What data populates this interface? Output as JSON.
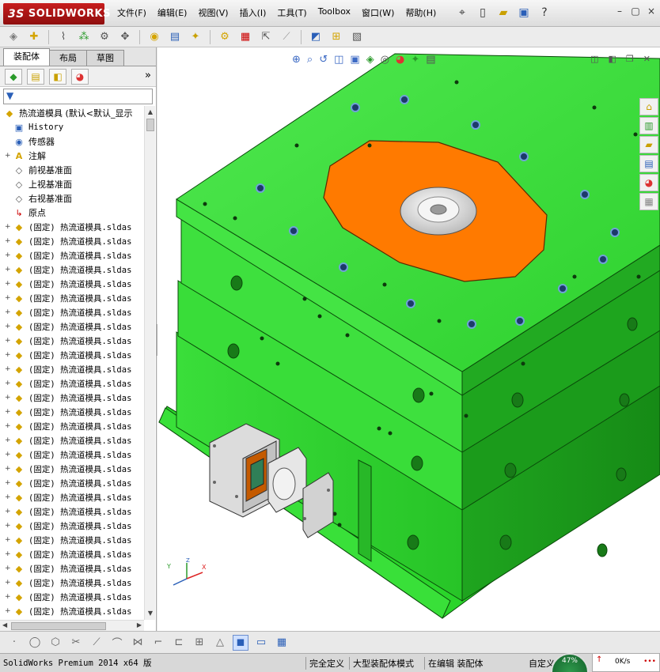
{
  "app": {
    "logo_ds": "3S",
    "logo_text": "SOLIDWORKS"
  },
  "menu": [
    "文件(F)",
    "编辑(E)",
    "视图(V)",
    "插入(I)",
    "工具(T)",
    "Toolbox",
    "窗口(W)",
    "帮助(H)"
  ],
  "title_tools": [
    "pin-icon",
    "new-document-icon",
    "open-icon",
    "save-icon",
    "help-icon"
  ],
  "window_controls": {
    "minimize": "–",
    "restore": "▢",
    "close": "×"
  },
  "command_toolbar": [
    "edit-component-icon",
    "insert-component-icon",
    "mate-icon",
    "linear-pattern-icon",
    "smart-fasteners-icon",
    "move-component-icon",
    "show-hidden-icon",
    "assembly-features-icon",
    "reference-geometry-icon",
    "new-motion-study-icon",
    "bill-of-materials-icon",
    "exploded-view-icon",
    "explode-line-icon",
    "interference-icon",
    "clearance-icon",
    "hole-alignment-icon",
    "measure-icon",
    "mass-properties-icon"
  ],
  "left_panel": {
    "tabs": [
      "装配体",
      "布局",
      "草图"
    ],
    "active_tab": "装配体",
    "fm_icons": [
      "feature-manager-icon",
      "property-manager-icon",
      "configuration-manager-icon",
      "display-manager-icon"
    ],
    "more": "»",
    "tree": {
      "root": "热流道模具  (默认<默认_显示",
      "items": [
        {
          "label": "History",
          "icon": "history-icon",
          "expand": "",
          "mono": true
        },
        {
          "label": "传感器",
          "icon": "sensor-icon",
          "expand": "",
          "mono": false
        },
        {
          "label": "注解",
          "icon": "annotation-icon",
          "expand": "+",
          "mono": false
        },
        {
          "label": "前视基准面",
          "icon": "plane-icon",
          "expand": "",
          "mono": false
        },
        {
          "label": "上视基准面",
          "icon": "plane-icon",
          "expand": "",
          "mono": false
        },
        {
          "label": "右视基准面",
          "icon": "plane-icon",
          "expand": "",
          "mono": false
        },
        {
          "label": "原点",
          "icon": "origin-icon",
          "expand": "",
          "mono": false
        }
      ],
      "component_label": "(固定) 热流道模具.sldas",
      "component_count": 28
    }
  },
  "heads_up_toolbar": [
    "zoom-to-fit-icon",
    "zoom-to-area-icon",
    "previous-view-icon",
    "section-view-icon",
    "view-orientation-icon",
    "display-style-icon",
    "hide-show-items-icon",
    "edit-appearance-icon",
    "apply-scene-icon",
    "view-settings-icon"
  ],
  "viewport_controls": [
    "split-horizontal-icon",
    "split-vertical-icon",
    "restore-viewport-icon",
    "close-viewport-icon"
  ],
  "task_pane": [
    "solidworks-resources-icon",
    "design-library-icon",
    "file-explorer-icon",
    "view-palette-icon",
    "appearances-icon",
    "custom-properties-icon"
  ],
  "triad": {
    "x": "X",
    "y": "Y",
    "z": "Z"
  },
  "view_toolbar": [
    "point-icon",
    "circle-icon",
    "polygon-icon",
    "trim-icon",
    "extend-icon",
    "fillet-icon",
    "mirror-icon",
    "offset-icon",
    "dimension-icon",
    "grid-icon",
    "relation-icon",
    "shaded-view-icon",
    "display-pane-icon",
    "table-icon"
  ],
  "status": {
    "app": "SolidWorks Premium 2014 x64 版",
    "definition": "完全定义",
    "mode": "大型装配体模式",
    "editing": "在编辑 装配体",
    "custom": "自定义",
    "gauge": "47%",
    "speed": "0K/s"
  },
  "colors": {
    "mold_green": "#33dd33",
    "mold_green_dark": "#1aa61a",
    "plate_orange": "#ff7a00",
    "titlebar_red": "#b01616",
    "tree_highlight": "#d4a400"
  }
}
